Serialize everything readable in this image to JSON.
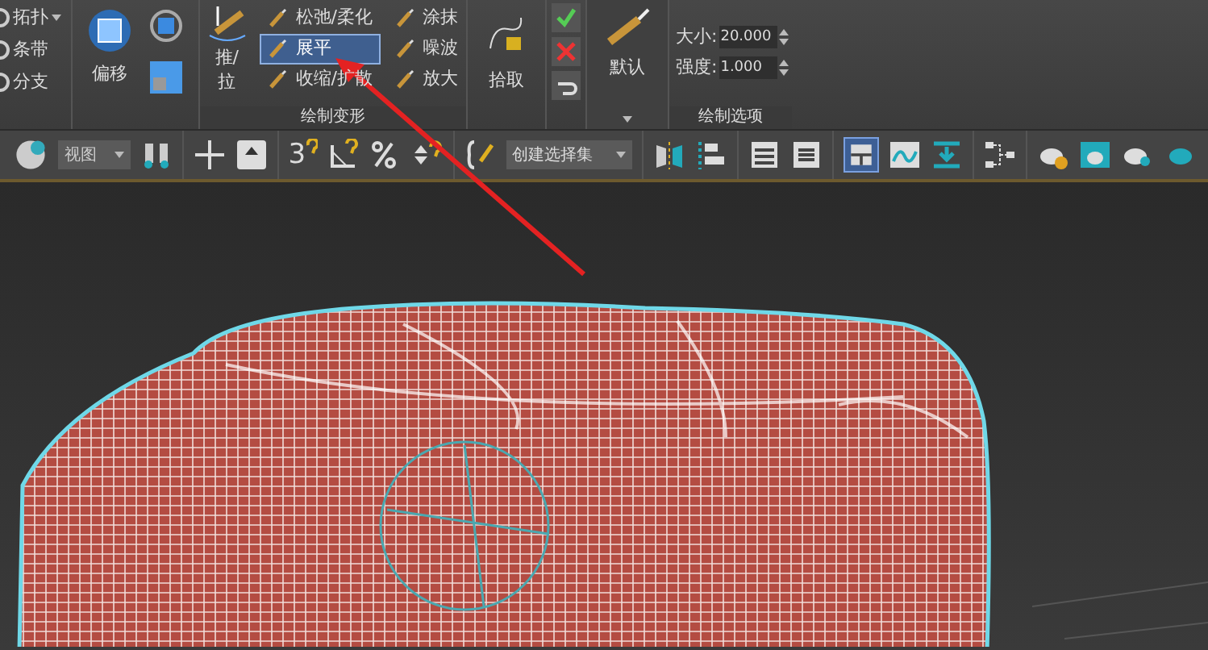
{
  "ribbon": {
    "topology_items": [
      {
        "label": "拓扑",
        "has_dropdown": true
      },
      {
        "label": "条带",
        "has_dropdown": false
      },
      {
        "label": "分支",
        "has_dropdown": false
      }
    ],
    "offset": {
      "label": "偏移"
    },
    "paint_deform": {
      "push_pull_lines": [
        "推/",
        "拉"
      ],
      "tools": [
        {
          "label": "松弛/柔化",
          "selected": false
        },
        {
          "label": "展平",
          "selected": true
        },
        {
          "label": "收缩/扩散",
          "selected": false
        },
        {
          "label": "涂抹",
          "selected": false
        },
        {
          "label": "噪波",
          "selected": false
        },
        {
          "label": "放大",
          "selected": false
        }
      ],
      "title": "绘制变形"
    },
    "pick": {
      "label": "拾取"
    },
    "brush": {
      "label": "默认"
    },
    "paint_options": {
      "fields": [
        {
          "label": "大小:",
          "value": "20.000"
        },
        {
          "label": "强度:",
          "value": "1.000"
        }
      ],
      "title": "绘制选项"
    }
  },
  "toolbar": {
    "snap_label": "3",
    "view_dropdown": "视图",
    "selection_set_dropdown": "创建选择集"
  }
}
